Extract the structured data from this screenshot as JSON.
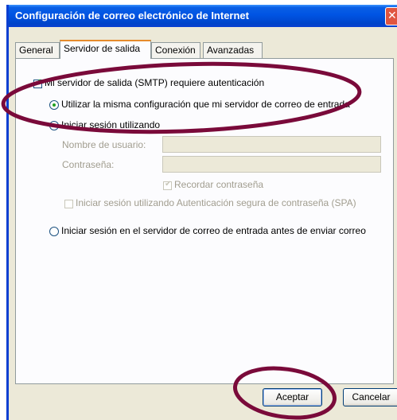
{
  "window": {
    "title": "Configuración de correo electrónico de Internet",
    "close_glyph": "✕"
  },
  "tabs": [
    {
      "label": "General",
      "active": false
    },
    {
      "label": "Servidor de salida",
      "active": true
    },
    {
      "label": "Conexión",
      "active": false
    },
    {
      "label": "Avanzadas",
      "active": false
    }
  ],
  "smtp_auth": {
    "label": "Mi servidor de salida (SMTP) requiere autenticación",
    "checked": true
  },
  "options": {
    "same_settings": {
      "label": "Utilizar la misma configuración que mi servidor de correo de entrada",
      "selected": true
    },
    "login_using": {
      "label": "Iniciar sesión utilizando",
      "selected": false
    },
    "login_before_send": {
      "label": "Iniciar sesión en el servidor de correo de entrada antes de enviar correo",
      "selected": false
    }
  },
  "credentials": {
    "username_label": "Nombre de usuario:",
    "username_value": "",
    "password_label": "Contraseña:",
    "password_value": "",
    "remember_label": "Recordar contraseña",
    "remember_checked": true,
    "spa_label": "Iniciar sesión utilizando Autenticación segura de contraseña (SPA)",
    "spa_checked": false
  },
  "buttons": {
    "accept": "Aceptar",
    "cancel": "Cancelar"
  },
  "colors": {
    "annotation": "#7a0a3a",
    "titlebar": "#0054e3",
    "check": "#21a121"
  }
}
